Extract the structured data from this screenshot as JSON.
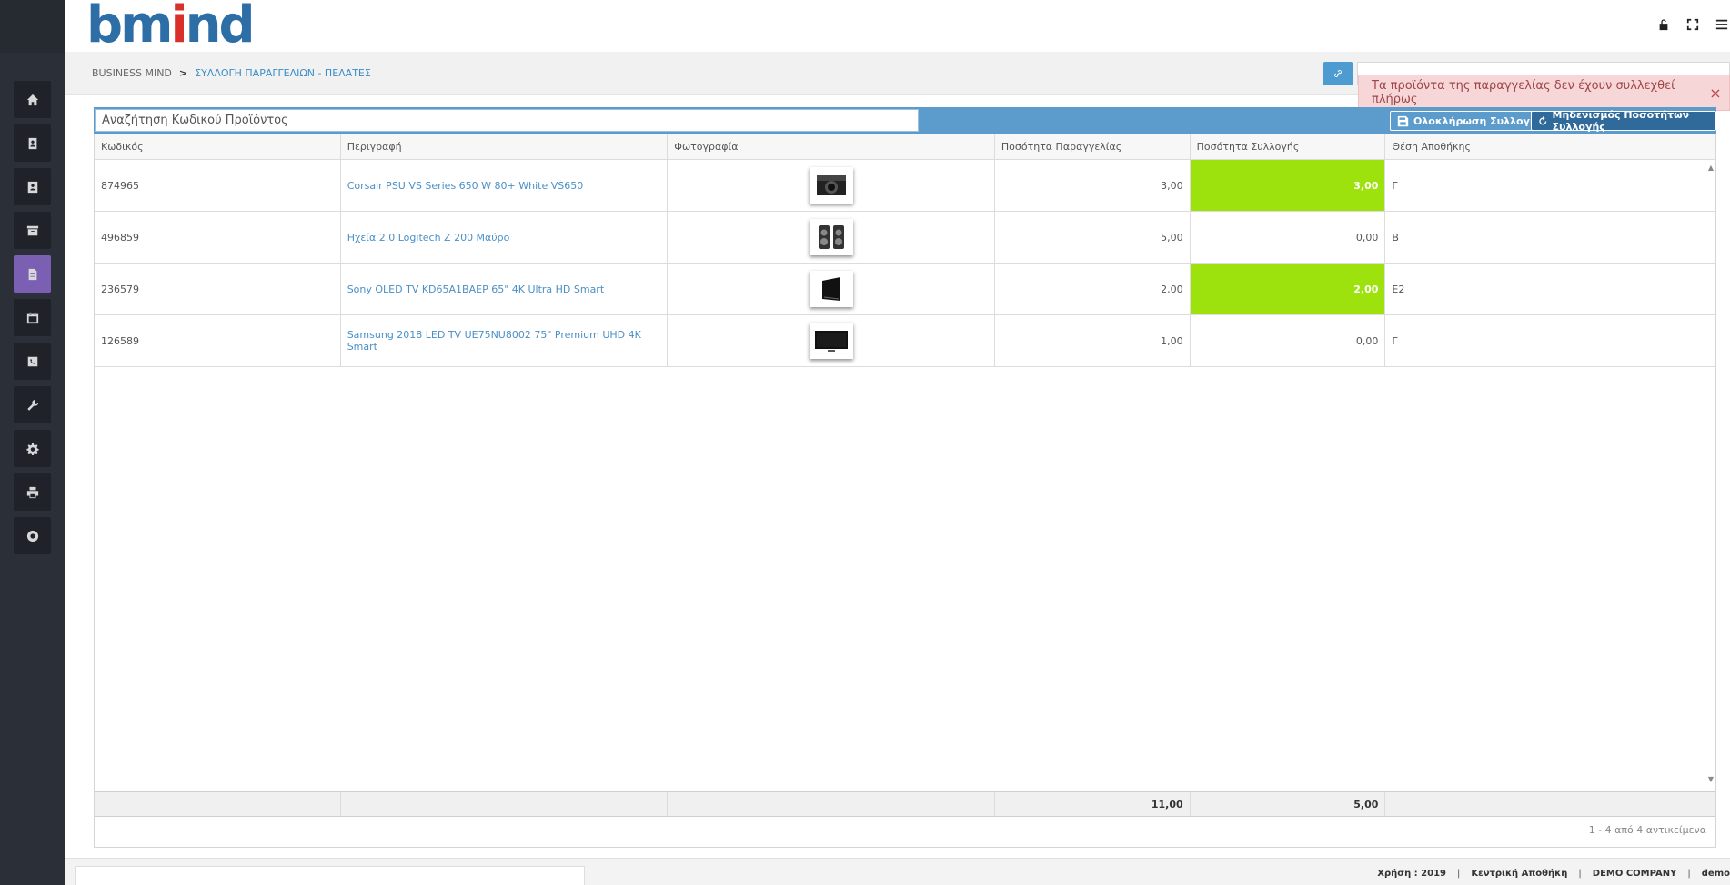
{
  "app": {
    "logo_main": "bm",
    "logo_dot": "i",
    "logo_rest": "nd"
  },
  "breadcrumb": {
    "root": "BUSINESS MIND",
    "separator": ">",
    "current": "ΣΥΛΛΟΓΗ ΠΑΡΑΓΓΕΛΙΩΝ - ΠΕΛΑΤΕΣ"
  },
  "notification": {
    "message": "Τα προϊόντα της παραγγελίας δεν έχουν συλλεχθεί πλήρως",
    "close": "×"
  },
  "toolbar": {
    "search_placeholder": "Αναζήτηση Κωδικού Προϊόντος",
    "complete_label": "Ολοκλήρωση Συλλογής",
    "reset_label": "Μηδενισμός Ποσοτήτων Συλλογής"
  },
  "grid": {
    "columns": [
      "Κωδικός",
      "Περιγραφή",
      "Φωτογραφία",
      "Ποσότητα Παραγγελίας",
      "Ποσότητα Συλλογής",
      "Θέση Αποθήκης"
    ],
    "rows": [
      {
        "code": "874965",
        "description": "Corsair PSU VS Series 650 W 80+ White VS650",
        "photo": "psu-icon",
        "order_qty": "3,00",
        "collected_qty": "3,00",
        "complete": true,
        "location": "Γ"
      },
      {
        "code": "496859",
        "description": "Ηχεία 2.0 Logitech Z 200 Μαύρο",
        "photo": "speakers-icon",
        "order_qty": "5,00",
        "collected_qty": "0,00",
        "complete": false,
        "location": "Β"
      },
      {
        "code": "236579",
        "description": "Sony OLED TV KD65A1BAEP 65\" 4K Ultra HD Smart",
        "photo": "oled-tv-icon",
        "order_qty": "2,00",
        "collected_qty": "2,00",
        "complete": true,
        "location": "Ε2"
      },
      {
        "code": "126589",
        "description": "Samsung 2018 LED TV UE75NU8002 75\" Premium UHD 4K Smart",
        "photo": "led-tv-icon",
        "order_qty": "1,00",
        "collected_qty": "0,00",
        "complete": false,
        "location": "Γ"
      }
    ],
    "totals": {
      "order_qty": "11,00",
      "collected_qty": "5,00"
    },
    "pager": "1 - 4 από 4 αντικείμενα"
  },
  "status": {
    "year": "Χρήση : 2019",
    "warehouse": "Κεντρική Αποθήκη",
    "company": "DEMO COMPANY",
    "user": "demo",
    "sep": "|"
  },
  "colors": {
    "highlight": "#9ee20d",
    "accent": "#5b9ccd",
    "sidebar": "#2b3038",
    "active_nav": "#7a5fb3"
  }
}
